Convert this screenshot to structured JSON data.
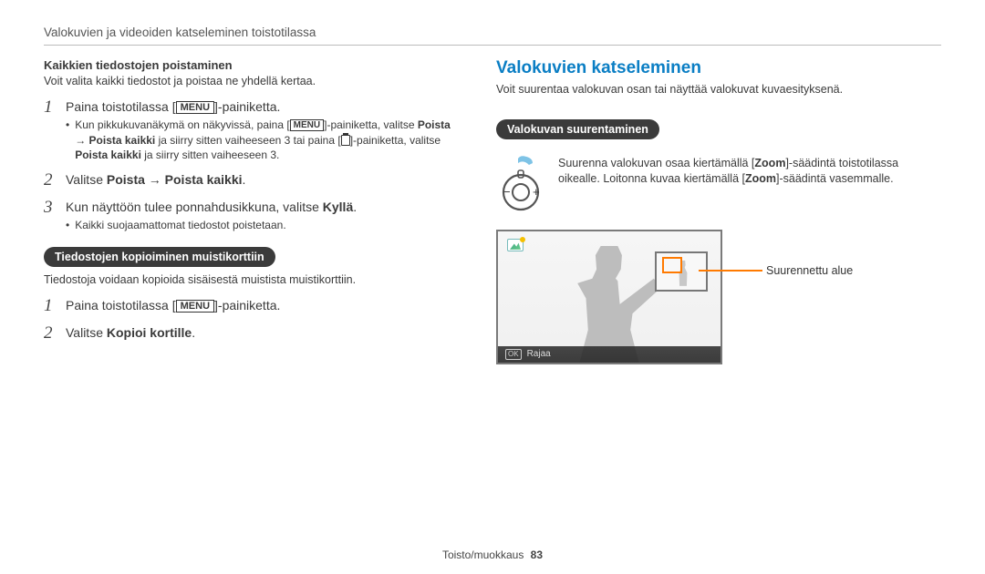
{
  "header": "Valokuvien ja videoiden katseleminen toistotilassa",
  "left": {
    "delete_all_title": "Kaikkien tiedostojen poistaminen",
    "delete_all_text": "Voit valita kaikki tiedostot ja poistaa ne yhdellä kertaa.",
    "steps_delete": {
      "s1a": "Paina toistotilassa [",
      "s1b": "]-painiketta.",
      "b1a": "Kun pikkukuvanäkymä on näkyvissä, paina [",
      "b1b": "]-painiketta, valitse ",
      "b1c": "Poista → Poista kaikki",
      "b1d": " ja siirry sitten vaiheeseen 3 tai paina [",
      "b1e": "]-painiketta, valitse ",
      "b1f": "Poista kaikki",
      "b1g": " ja siirry sitten vaiheeseen 3.",
      "s2a": "Valitse ",
      "s2b": "Poista → Poista kaikki",
      "s2c": ".",
      "s3a": "Kun näyttöön tulee ponnahdusikkuna, valitse ",
      "s3b": "Kyllä",
      "s3c": ".",
      "b3": "Kaikki suojaamattomat tiedostot poistetaan."
    },
    "pill_copy": "Tiedostojen kopioiminen muistikorttiin",
    "copy_text": "Tiedostoja voidaan kopioida sisäisestä muistista muistikorttiin.",
    "steps_copy": {
      "s1a": "Paina toistotilassa [",
      "s1b": "]-painiketta.",
      "s2a": "Valitse ",
      "s2b": "Kopioi kortille",
      "s2c": "."
    },
    "menu_label": "MENU"
  },
  "right": {
    "title": "Valokuvien katseleminen",
    "intro": "Voit suurentaa valokuvan osan tai näyttää valokuvat kuvaesityksenä.",
    "pill_zoom": "Valokuvan suurentaminen",
    "zoom_text_a": "Suurenna valokuvan osaa kiertämällä [",
    "zoom_text_b": "Zoom",
    "zoom_text_c": "]-säädintä toistotilassa oikealle. Loitonna kuvaa kiertämällä [",
    "zoom_text_d": "Zoom",
    "zoom_text_e": "]-säädintä vasemmalle.",
    "dial_minus": "−",
    "dial_plus": "+",
    "callout": "Suurennettu alue",
    "ok": "OK",
    "rajaa": "Rajaa"
  },
  "footer": {
    "section": "Toisto/muokkaus",
    "page": "83"
  },
  "nums": {
    "n1": "1",
    "n2": "2",
    "n3": "3"
  }
}
